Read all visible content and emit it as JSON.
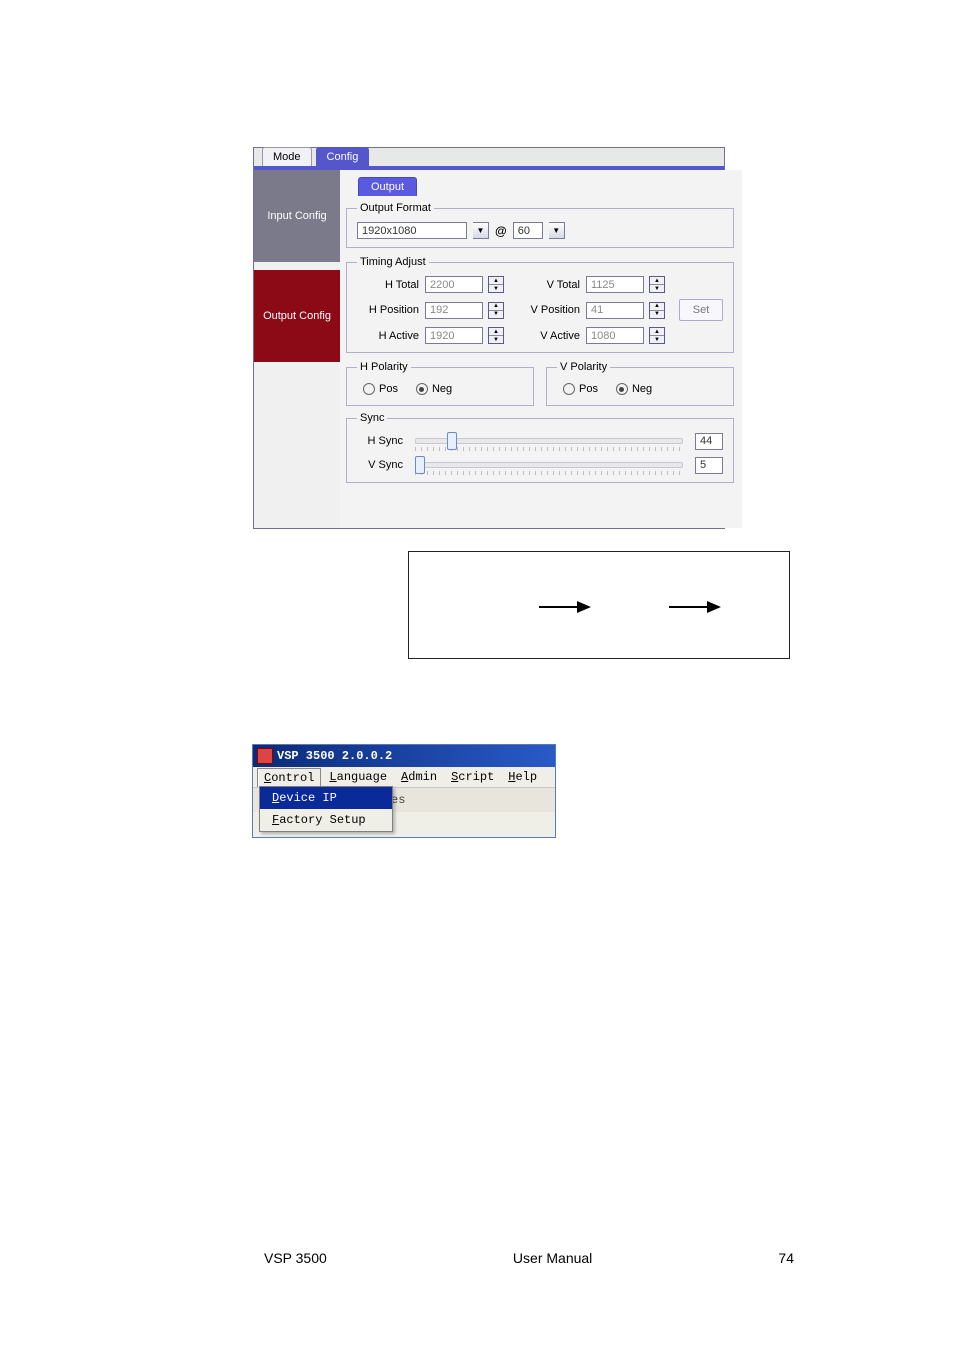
{
  "win1": {
    "tabs": {
      "mode": "Mode",
      "config": "Config"
    },
    "sidebar": {
      "input": "Input Config",
      "output": "Output Config"
    },
    "inner_tab": "Output",
    "output_format": {
      "legend": "Output Format",
      "resolution": "1920x1080",
      "at": "@",
      "refresh": "60"
    },
    "timing": {
      "legend": "Timing Adjust",
      "h_total_label": "H Total",
      "h_total": "2200",
      "v_total_label": "V Total",
      "v_total": "1125",
      "h_pos_label": "H Position",
      "h_pos": "192",
      "v_pos_label": "V Position",
      "v_pos": "41",
      "h_act_label": "H Active",
      "h_act": "1920",
      "v_act_label": "V Active",
      "v_act": "1080",
      "set": "Set"
    },
    "polarity": {
      "h_legend": "H Polarity",
      "v_legend": "V Polarity",
      "pos": "Pos",
      "neg": "Neg",
      "h_value": "Neg",
      "v_value": "Neg"
    },
    "sync": {
      "legend": "Sync",
      "h_label": "H Sync",
      "v_label": "V Sync",
      "h_val": "44",
      "v_val": "5"
    }
  },
  "win2": {
    "title": "VSP 3500 2.0.0.2",
    "menu": {
      "control": "Control",
      "language": "Language",
      "admin": "Admin",
      "script": "Script",
      "help": "Help"
    },
    "dropdown": {
      "device_ip": "Device IP",
      "factory_setup": "Factory Setup"
    },
    "toolbar_fragment": "es"
  },
  "footer": {
    "left": "VSP 3500",
    "center": "User Manual",
    "right": "74"
  }
}
